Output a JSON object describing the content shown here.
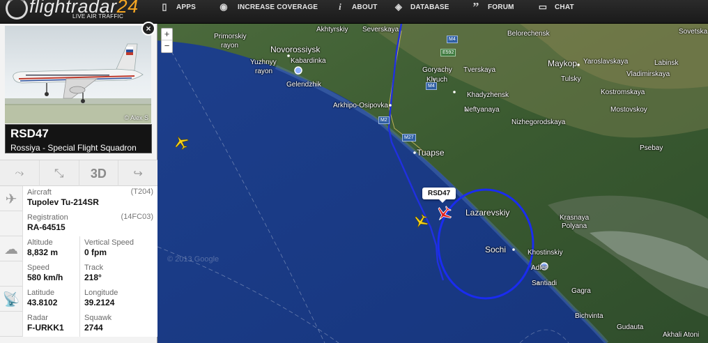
{
  "header": {
    "logo_text": "flightradar",
    "logo_num": "24",
    "logo_tagline": "LIVE AIR TRAFFIC",
    "nav": [
      {
        "label": "APPS",
        "icon": "phone-icon"
      },
      {
        "label": "INCREASE COVERAGE",
        "icon": "eye-icon"
      },
      {
        "label": "ABOUT",
        "icon": "info-icon"
      },
      {
        "label": "DATABASE",
        "icon": "database-icon"
      },
      {
        "label": "FORUM",
        "icon": "quote-icon"
      },
      {
        "label": "CHAT",
        "icon": "chat-icon"
      }
    ]
  },
  "flight_panel": {
    "photo_credit": "© Alex S",
    "close": "×",
    "callsign": "RSD47",
    "airline": "Rossiya - Special Flight Squadron",
    "tools": {
      "threed": "3D"
    },
    "aircraft_label": "Aircraft",
    "aircraft_code": "(T204)",
    "aircraft": "Tupolev Tu-214SR",
    "registration_label": "Registration",
    "registration_code": "(14FC03)",
    "registration": "RA-64515",
    "altitude_label": "Altitude",
    "altitude": "8,832 m",
    "vspeed_label": "Vertical Speed",
    "vspeed": "0 fpm",
    "speed_label": "Speed",
    "speed": "580 km/h",
    "track_label": "Track",
    "track": "218°",
    "latitude_label": "Latitude",
    "latitude": "43.8102",
    "longitude_label": "Longitude",
    "longitude": "39.2124",
    "radar_label": "Radar",
    "radar": "F-URKK1",
    "squawk_label": "Squawk",
    "squawk": "2744"
  },
  "map": {
    "zoom_in": "+",
    "zoom_out": "−",
    "selected_flight_label": "RSD47",
    "watermark": "© 2013 Google",
    "cities": {
      "akhtyrskiy": "Akhtyrskiy",
      "severskaya": "Severskaya",
      "belorechensk": "Belorechensk",
      "sovetskaya": "Sovetska",
      "primorskiy": "Primorskiy",
      "rayon1": "rayon",
      "novorossiysk": "Novorossiysk",
      "yuzhnyy": "Yuzhnyy",
      "kabardinka": "Kabardinka",
      "rayon2": "rayon",
      "gelendzhik": "Gelendzhik",
      "goryachy": "Goryachy",
      "klyuch": "Klyuch",
      "tverskaya": "Tverskaya",
      "maykop": "Maykop",
      "yaroslavskaya": "Yaroslavskaya",
      "labinsk": "Labinsk",
      "vladimirskaya": "Vladimirskaya",
      "tulsky": "Tulsky",
      "kostromskaya": "Kostromskaya",
      "khadyzhensk": "Khadyzhensk",
      "arkhipo": "Arkhipo-Osipovka",
      "neftyanaya": "Neftyanaya",
      "mostovskoy": "Mostovskoy",
      "nizhegorodskaya": "Nizhegorodskaya",
      "psebay": "Psebay",
      "tuapse": "Tuapse",
      "lazarevskiy": "Lazarevskiy",
      "krasnaya": "Krasnaya",
      "polyana": "Polyana",
      "sochi": "Sochi",
      "khostinskiy": "Khostinskiy",
      "adler": "Adler",
      "santiadi": "Santiadi",
      "gagra": "Gagra",
      "bichvinta": "Bichvinta",
      "gudauta": "Gudauta",
      "akhali_atoni": "Akhali Atoni"
    },
    "roads": {
      "m4a": "M4",
      "e592": "E592",
      "m4b": "M4",
      "m2": "M2",
      "m27": "M27"
    }
  }
}
